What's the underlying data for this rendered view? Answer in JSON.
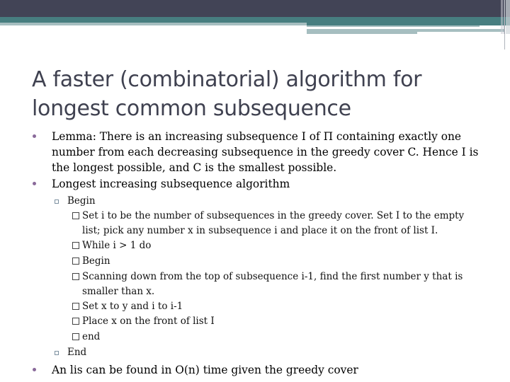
{
  "slide": {
    "title": "A faster (combinatorial) algorithm for longest common subsequence",
    "bullets": [
      {
        "text": "Lemma: There is an increasing subsequence I of Π containing exactly one number from each decreasing subsequence in the greedy cover C. Hence I is the longest possible, and C is the smallest possible."
      },
      {
        "text": "Longest increasing subsequence algorithm",
        "sub": [
          {
            "text": "Begin",
            "steps": [
              "Set i to be the number of subsequences in the greedy cover. Set I to the empty list; pick any number x in subsequence i and place it on the front of list I.",
              "While i > 1 do",
              "Begin",
              "Scanning down from the top of subsequence i-1, find the first number y that is smaller than x.",
              "Set x to y and i to i-1",
              "Place x on the front of list I",
              "end"
            ]
          },
          {
            "text": "End"
          }
        ]
      },
      {
        "text": "An lis can be found in O(n) time given the greedy cover"
      }
    ]
  },
  "theme": {
    "header_dark": "#424456",
    "header_teal": "#477E80",
    "header_light": "#A6BEC0",
    "title_color": "#3f4150",
    "bullet_color": "#8a6a9a"
  }
}
